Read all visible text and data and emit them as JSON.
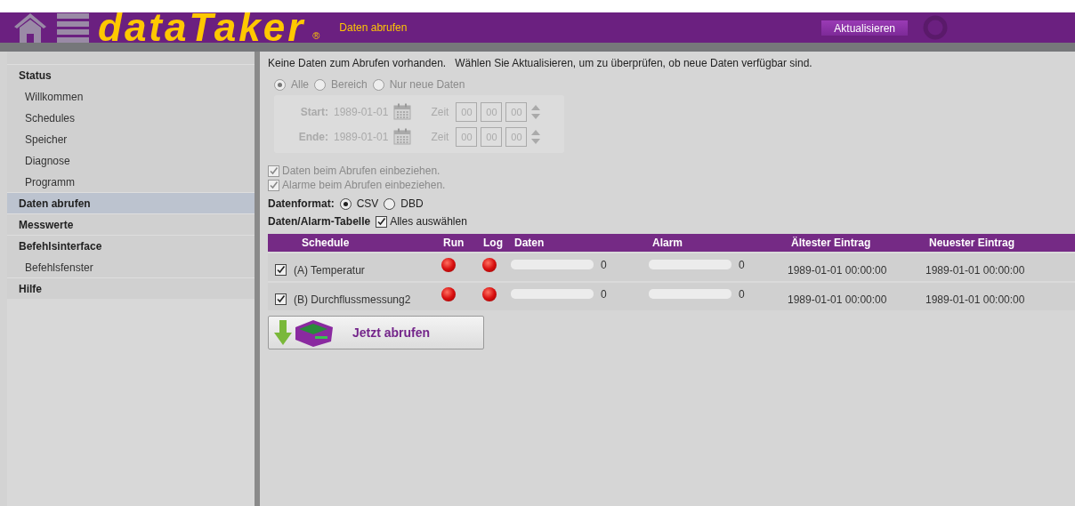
{
  "header": {
    "logo": "dataTaker",
    "logo_mark": "®",
    "page_title": "Daten abrufen",
    "refresh_button": "Aktualisieren"
  },
  "sidebar": {
    "items": [
      {
        "label": "Status",
        "selected": false,
        "children": [
          {
            "label": "Willkommen",
            "selected": false
          },
          {
            "label": "Schedules",
            "selected": false
          },
          {
            "label": "Speicher",
            "selected": false
          },
          {
            "label": "Diagnose",
            "selected": false
          },
          {
            "label": "Programm",
            "selected": false
          }
        ]
      },
      {
        "label": "Daten abrufen",
        "selected": true
      },
      {
        "label": "Messwerte",
        "selected": false
      },
      {
        "label": "Befehlsinterface",
        "selected": false,
        "children": [
          {
            "label": "Befehlsfenster",
            "selected": false
          }
        ]
      },
      {
        "label": "Hilfe",
        "selected": false
      }
    ]
  },
  "main": {
    "message": "Keine Daten zum Abrufen vorhanden.   Wählen Sie Aktualisieren, um zu überprüfen, ob neue Daten verfügbar sind.",
    "range": {
      "disabled": true,
      "options": [
        {
          "label": "Alle",
          "selected": true
        },
        {
          "label": "Bereich",
          "selected": false
        },
        {
          "label": "Nur neue Daten",
          "selected": false
        }
      ],
      "rows": [
        {
          "label": "Start:",
          "date": "1989-01-01",
          "time_label": "Zeit",
          "time": [
            "00",
            "00",
            "00"
          ]
        },
        {
          "label": "Ende:",
          "date": "1989-01-01",
          "time_label": "Zeit",
          "time": [
            "00",
            "00",
            "00"
          ]
        }
      ]
    },
    "options": [
      {
        "label": "Daten beim Abrufen einbeziehen.",
        "checked": true,
        "disabled": true
      },
      {
        "label": "Alarme beim Abrufen einbeziehen.",
        "checked": true,
        "disabled": true
      }
    ],
    "format": {
      "label": "Datenformat:",
      "options": [
        {
          "label": "CSV",
          "selected": true
        },
        {
          "label": "DBD",
          "selected": false
        }
      ]
    },
    "table_select": {
      "label": "Daten/Alarm-Tabelle",
      "select_all": {
        "label": "Alles auswählen",
        "checked": true
      }
    },
    "table": {
      "columns": [
        "Schedule",
        "Run",
        "Log",
        "Daten",
        "Alarm",
        "Ältester Eintrag",
        "Neuester Eintrag"
      ],
      "rows": [
        {
          "checked": true,
          "name": "(A) Temperatur",
          "run": {
            "color": "#d81010"
          },
          "log": {
            "color": "#d81010"
          },
          "data": {
            "level": 0,
            "reading": "0"
          },
          "alarm": {
            "level": 0,
            "reading": "0"
          },
          "oldest": "1989-01-01 00:00:00",
          "newest": "1989-01-01 00:00:00"
        },
        {
          "checked": true,
          "name": "(B) Durchflussmessung2",
          "run": {
            "color": "#d81010"
          },
          "log": {
            "color": "#d81010"
          },
          "data": {
            "level": 0,
            "reading": "0"
          },
          "alarm": {
            "level": 0,
            "reading": "0"
          },
          "oldest": "1989-01-01 00:00:00",
          "newest": "1989-01-01 00:00:00"
        }
      ]
    },
    "fetch_button": "Jetzt abrufen"
  }
}
